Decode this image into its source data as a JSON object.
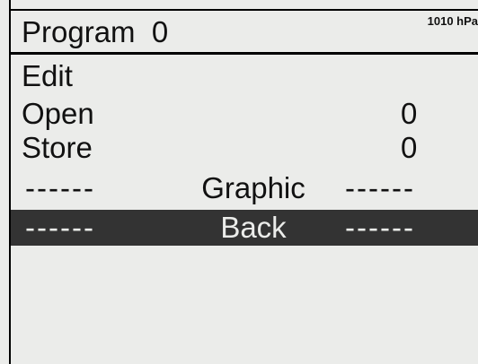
{
  "header": {
    "title": "Program  0",
    "pressure": "1010 hPa"
  },
  "menu": {
    "items": [
      {
        "label": "Edit",
        "value": ""
      },
      {
        "label": "Open",
        "value": "0"
      },
      {
        "label": "Store",
        "value": "0"
      }
    ],
    "graphic": {
      "dashes_left": "------",
      "label": "Graphic",
      "dashes_right": "------"
    },
    "back": {
      "dashes_left": "------",
      "label": "Back",
      "dashes_right": "------",
      "selected": true
    }
  },
  "colors": {
    "background": "#ebecea",
    "text": "#111111",
    "selection": "#333333"
  }
}
